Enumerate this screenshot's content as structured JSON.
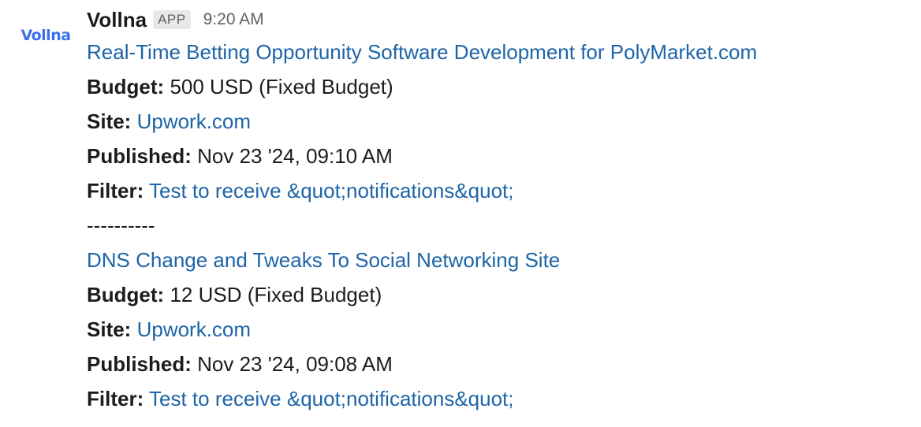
{
  "message": {
    "avatar_text": "Vollna",
    "sender": "Vollna",
    "badge": "APP",
    "timestamp": "9:20 AM",
    "jobs": [
      {
        "title": "Real-Time Betting Opportunity Software Development for PolyMarket.com",
        "budget_label": "Budget:",
        "budget": "500 USD (Fixed Budget)",
        "site_label": "Site:",
        "site": "Upwork.com",
        "published_label": "Published:",
        "published": "Nov 23 '24, 09:10 AM",
        "filter_label": "Filter:",
        "filter": "Test to receive &quot;notifications&quot;"
      },
      {
        "title": "DNS Change and Tweaks To Social Networking Site",
        "budget_label": "Budget:",
        "budget": "12 USD (Fixed Budget)",
        "site_label": "Site:",
        "site": "Upwork.com",
        "published_label": "Published:",
        "published": "Nov 23 '24, 09:08 AM",
        "filter_label": "Filter:",
        "filter": "Test to receive &quot;notifications&quot;"
      }
    ],
    "divider": "----------"
  },
  "colors": {
    "link": "#1d64a8",
    "avatar": "#3b6ee8",
    "text": "#1d1c1d",
    "muted": "#616061",
    "badge_bg": "#e8e8e8"
  }
}
